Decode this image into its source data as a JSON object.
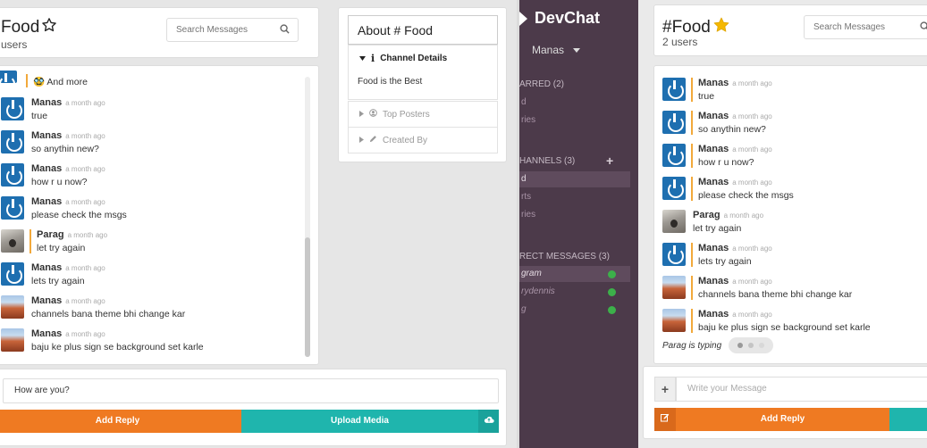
{
  "left_window": {
    "channel_title": "Food",
    "users_text": "users",
    "search_placeholder": "Search Messages",
    "partial_message": "🥸 And more",
    "messages": [
      {
        "name": "Manas",
        "time": "a month ago",
        "text": "true",
        "avatar": "blue",
        "bar": false
      },
      {
        "name": "Manas",
        "time": "a month ago",
        "text": "so anythin new?",
        "avatar": "blue",
        "bar": false
      },
      {
        "name": "Manas",
        "time": "a month ago",
        "text": "how r u now?",
        "avatar": "blue",
        "bar": false
      },
      {
        "name": "Manas",
        "time": "a month ago",
        "text": "please check the msgs",
        "avatar": "blue",
        "bar": false
      },
      {
        "name": "Parag",
        "time": "a month ago",
        "text": "let try again",
        "avatar": "koala",
        "bar": true
      },
      {
        "name": "Manas",
        "time": "a month ago",
        "text": "lets try again",
        "avatar": "blue",
        "bar": false
      },
      {
        "name": "Manas",
        "time": "a month ago",
        "text": "channels bana theme bhi change kar",
        "avatar": "canyon",
        "bar": false
      },
      {
        "name": "Manas",
        "time": "a month ago",
        "text": "baju ke plus sign se background set karle",
        "avatar": "canyon",
        "bar": false
      }
    ],
    "input_value": "How are you?",
    "add_reply_label": "Add Reply",
    "upload_media_label": "Upload Media"
  },
  "about_panel": {
    "title": "About # Food",
    "channel_details_label": "Channel Details",
    "channel_details_text": "Food is the Best",
    "top_posters_label": "Top Posters",
    "created_by_label": "Created By"
  },
  "sidebar": {
    "app_name": "DevChat",
    "user_name": "Manas",
    "starred_label": "ARRED (2)",
    "starred_items": [
      "d",
      "ries"
    ],
    "channels_label": "HANNELS (3)",
    "channel_items": [
      "d",
      "rts",
      "ries"
    ],
    "direct_messages_label": "RECT MESSAGES (3)",
    "dm_items": [
      "gram",
      "rydennis",
      "g"
    ],
    "online_color": "#3cb04a"
  },
  "right_window": {
    "channel_title": "#Food",
    "users_text": "2 users",
    "search_placeholder": "Search Messages",
    "messages": [
      {
        "name": "Manas",
        "time": "a month ago",
        "text": "true",
        "avatar": "blue",
        "bar": true
      },
      {
        "name": "Manas",
        "time": "a month ago",
        "text": "so anythin new?",
        "avatar": "blue",
        "bar": true
      },
      {
        "name": "Manas",
        "time": "a month ago",
        "text": "how r u now?",
        "avatar": "blue",
        "bar": true
      },
      {
        "name": "Manas",
        "time": "a month ago",
        "text": "please check the msgs",
        "avatar": "blue",
        "bar": true
      },
      {
        "name": "Parag",
        "time": "a month ago",
        "text": "let try again",
        "avatar": "koala",
        "bar": false
      },
      {
        "name": "Manas",
        "time": "a month ago",
        "text": "lets try again",
        "avatar": "blue",
        "bar": true
      },
      {
        "name": "Manas",
        "time": "a month ago",
        "text": "channels bana theme bhi change kar",
        "avatar": "canyon",
        "bar": true
      },
      {
        "name": "Manas",
        "time": "a month ago",
        "text": "baju ke plus sign se background set karle",
        "avatar": "canyon",
        "bar": true
      }
    ],
    "typing_text": "Parag is typing",
    "input_placeholder": "Write your Message",
    "add_reply_label": "Add Reply"
  },
  "colors": {
    "orange": "#ef7a22",
    "teal": "#1fb5ad",
    "sidebar_bg": "#4c3a4a",
    "avatar_blue": "#1e6fb0",
    "star_gold": "#f5b800"
  }
}
